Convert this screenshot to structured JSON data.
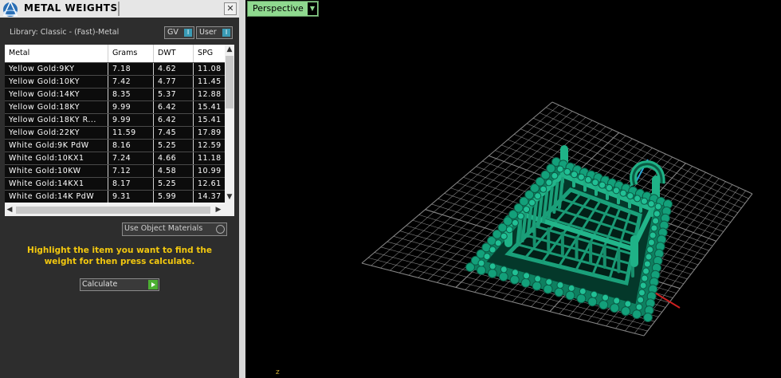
{
  "panel": {
    "title": "METAL WEIGHTS",
    "close_icon": "close-icon",
    "library": "Library: Classic - (Fast)-Metal",
    "toggles": [
      {
        "label": "GV",
        "icon": "toggle-icon"
      },
      {
        "label": "User",
        "icon": "toggle-icon"
      }
    ],
    "table": {
      "columns": [
        "Metal",
        "Grams",
        "DWT",
        "SPG"
      ],
      "rows": [
        [
          "Yellow Gold:9KY",
          "7.18",
          "4.62",
          "11.08"
        ],
        [
          "Yellow Gold:10KY",
          "7.42",
          "4.77",
          "11.45"
        ],
        [
          "Yellow Gold:14KY",
          "8.35",
          "5.37",
          "12.88"
        ],
        [
          "Yellow Gold:18KY",
          "9.99",
          "6.42",
          "15.41"
        ],
        [
          "Yellow Gold:18KY R...",
          "9.99",
          "6.42",
          "15.41"
        ],
        [
          "Yellow Gold:22KY",
          "11.59",
          "7.45",
          "17.89"
        ],
        [
          "White Gold:9K PdW",
          "8.16",
          "5.25",
          "12.59"
        ],
        [
          "White Gold:10KX1",
          "7.24",
          "4.66",
          "11.18"
        ],
        [
          "White Gold:10KW",
          "7.12",
          "4.58",
          "10.99"
        ],
        [
          "White Gold:14KX1",
          "8.17",
          "5.25",
          "12.61"
        ],
        [
          "White Gold:14K PdW",
          "9.31",
          "5.99",
          "14.37"
        ]
      ]
    },
    "use_object_materials": "Use Object Materials",
    "instructions": "Highlight the item you want to find the weight for then press calculate.",
    "calculate_label": "Calculate"
  },
  "viewport": {
    "view_label": "Perspective",
    "axis_label": "z"
  },
  "colors": {
    "panel_bg": "#2d2d2d",
    "instructions": "#f3c80f",
    "model": "#0e8060",
    "perspective_tab": "#8fd98f",
    "grid": "#9a9a9a"
  }
}
